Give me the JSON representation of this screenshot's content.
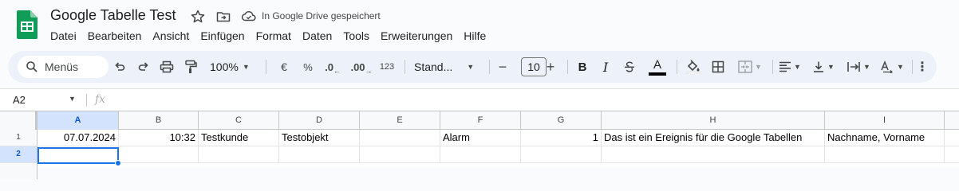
{
  "document": {
    "title": "Google Tabelle Test",
    "save_status": "In Google Drive gespeichert"
  },
  "menu": [
    "Datei",
    "Bearbeiten",
    "Ansicht",
    "Einfügen",
    "Format",
    "Daten",
    "Tools",
    "Erweiterungen",
    "Hilfe"
  ],
  "toolbar": {
    "search_label": "Menüs",
    "zoom": "100%",
    "currency_symbol": "€",
    "percent_symbol": "%",
    "decrease_decimals_label": ".0",
    "increase_decimals_label": ".00",
    "more_formats_label": "123",
    "font_name": "Stand...",
    "font_size": "10",
    "minus": "−",
    "plus": "+",
    "bold": "B",
    "italic": "I",
    "text_color_letter": "A",
    "text_color_bar": "#000000",
    "more": "⋮"
  },
  "formula_bar": {
    "name_box": "A2",
    "fx_label": "fx",
    "formula": ""
  },
  "grid": {
    "columns": [
      "A",
      "B",
      "C",
      "D",
      "E",
      "F",
      "G",
      "H",
      "I"
    ],
    "active_column": "A",
    "rows": [
      {
        "number": "1",
        "cells": [
          "07.07.2024",
          "10:32",
          "Testkunde",
          "Testobjekt",
          "",
          "Alarm",
          "1",
          "Das ist ein Ereignis für die Google Tabellen",
          "Nachname, Vorname"
        ]
      },
      {
        "number": "2",
        "cells": [
          "",
          "",
          "",
          "",
          "",
          "",
          "",
          "",
          ""
        ]
      }
    ],
    "selected_cell": "A2",
    "accent_color": "#1a73e8"
  },
  "colors": {
    "sheets_green": "#0f9d58",
    "toolbar_bg": "#edf2fa"
  }
}
